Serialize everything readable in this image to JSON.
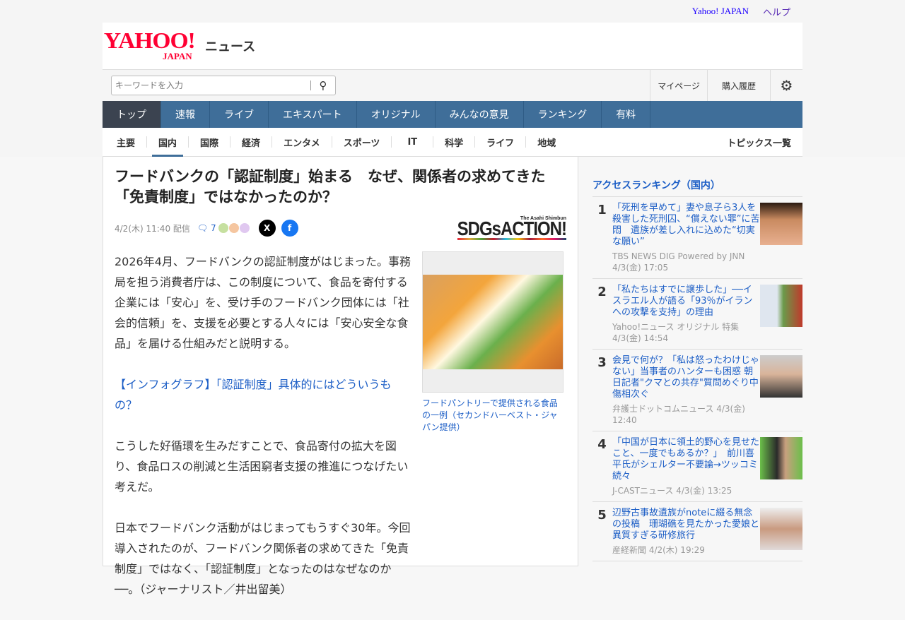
{
  "topbar": {
    "yahoo": "Yahoo! JAPAN",
    "help": "ヘルプ"
  },
  "logo": {
    "yahoo": "YAHOO!",
    "japan": "JAPAN",
    "news": "ニュース"
  },
  "search": {
    "placeholder": "キーワードを入力"
  },
  "header_links": {
    "mypage": "マイページ",
    "history": "購入履歴"
  },
  "nav": [
    "トップ",
    "速報",
    "ライブ",
    "エキスパート",
    "オリジナル",
    "みんなの意見",
    "ランキング",
    "有料"
  ],
  "subnav": [
    "主要",
    "国内",
    "国際",
    "経済",
    "エンタメ",
    "スポーツ",
    "IT",
    "科学",
    "ライフ",
    "地域"
  ],
  "topics": "トピックス一覧",
  "article": {
    "title": "フードバンクの「認証制度」始まる　なぜ、関係者の求めてきた「免責制度」ではなかったのか？",
    "date": "4/2(木) 11:40 配信",
    "comments": "7",
    "sdgs_small": "The Asahi Shimbun",
    "sdgs_big": "SDGsACTION!",
    "p1": "2026年4月、フードバンクの認証制度がはじまった。事務局を担う消費者庁は、この制度について、食品を寄付する企業には「安心」を、受け手のフードバンク団体には「社会的信頼」を、支援を必要とする人々には「安心安全な食品」を届ける仕組みだと説明する。",
    "link": "【インフォグラフ】「認証制度」具体的にはどういうもの？",
    "p2": "こうした好循環を生みだすことで、食品寄付の拡大を図り、食品ロスの削減と生活困窮者支援の推進につなげたい考えだ。",
    "p3": "日本でフードバンク活動がはじまってもうすぐ30年。今回導入されたのが、フードバンク関係者の求めてきた「免責制度」ではなく、「認証制度」となったのはなぜなのか──。（ジャーナリスト／井出留美）",
    "caption": "フードパントリーで提供される食品の一例（セカンドハーベスト・ジャパン提供）"
  },
  "ranking": {
    "title": "アクセスランキング（国内）",
    "items": [
      {
        "rank": "1",
        "title": "「死刑を早めて」妻や息子ら3人を殺害した死刑囚、“償えない罪”に苦悶　遺族が差し入れに込めた“切実な願い”",
        "source": "TBS NEWS DIG Powered by JNN 4/3(金) 17:05"
      },
      {
        "rank": "2",
        "title": "「私たちはすでに譲歩した」──イスラエル人が語る「93％がイランへの攻撃を支持」の理由",
        "source": "Yahoo!ニュース オリジナル 特集 4/3(金) 14:54"
      },
      {
        "rank": "3",
        "title": "会見で何が？「私は怒ったわけじゃない」当事者のハンターも困惑 朝日記者\"クマとの共存\"質問めぐり中傷相次ぐ",
        "source": "弁護士ドットコムニュース 4/3(金) 12:40"
      },
      {
        "rank": "4",
        "title": "「中国が日本に領土的野心を見せたこと、一度でもあるか？」　前川喜平氏がシェルター不要論→ツッコミ続々",
        "source": "J-CASTニュース 4/3(金) 13:25"
      },
      {
        "rank": "5",
        "title": "辺野古事故遺族がnoteに綴る無念の投稿　珊瑚礁を見たかった愛娘と異質すぎる研修旅行",
        "source": "産経新聞 4/2(木) 19:29"
      }
    ]
  }
}
